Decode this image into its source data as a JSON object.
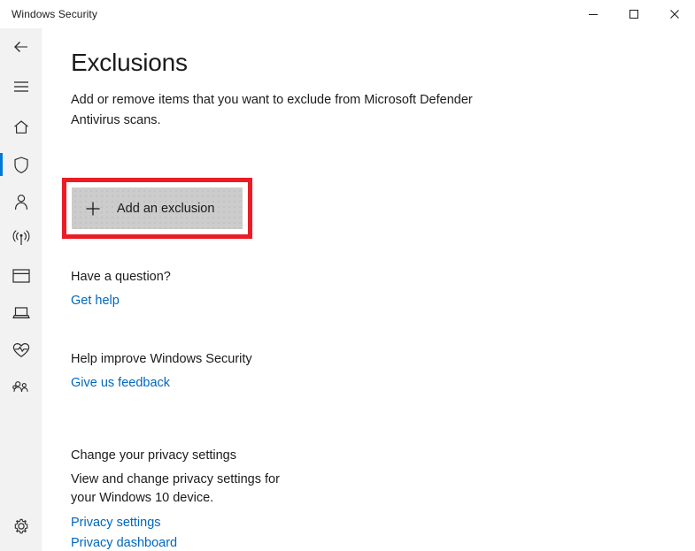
{
  "window": {
    "title": "Windows Security",
    "controls": [
      {
        "name": "minimize",
        "label": "Minimize"
      },
      {
        "name": "maximize",
        "label": "Maximize"
      },
      {
        "name": "close",
        "label": "Close"
      }
    ]
  },
  "nav": {
    "back_label": "Back",
    "menu_label": "Menu",
    "settings_label": "Settings",
    "items": [
      {
        "icon": "home-icon",
        "label": "Home",
        "selected": false
      },
      {
        "icon": "shield-icon",
        "label": "Virus & threat protection",
        "selected": true
      },
      {
        "icon": "person-icon",
        "label": "Account protection",
        "selected": false
      },
      {
        "icon": "wifi-signal-icon",
        "label": "Firewall & network protection",
        "selected": false
      },
      {
        "icon": "app-window-icon",
        "label": "App & browser control",
        "selected": false
      },
      {
        "icon": "laptop-icon",
        "label": "Device security",
        "selected": false
      },
      {
        "icon": "heart-pulse-icon",
        "label": "Device performance & health",
        "selected": false
      },
      {
        "icon": "people-icon",
        "label": "Family options",
        "selected": false
      }
    ]
  },
  "main": {
    "title": "Exclusions",
    "description": "Add or remove items that you want to exclude from Microsoft Defender Antivirus scans.",
    "add_button": {
      "label": "Add an exclusion",
      "icon": "plus-icon",
      "highlighted": true,
      "highlight_color": "#ec1c24"
    },
    "sections": [
      {
        "title": "Have a question?",
        "body": "",
        "links": [
          "Get help"
        ]
      },
      {
        "title": "Help improve Windows Security",
        "body": "",
        "links": [
          "Give us feedback"
        ]
      },
      {
        "title": "Change your privacy settings",
        "body": "View and change privacy settings for your Windows 10 device.",
        "links": [
          "Privacy settings",
          "Privacy dashboard"
        ]
      }
    ]
  },
  "colors": {
    "accent": "#0078d4",
    "link": "#0067c0",
    "highlight": "#ec1c24",
    "rail_bg": "#f2f2f2",
    "button_bg": "#cccccc"
  }
}
